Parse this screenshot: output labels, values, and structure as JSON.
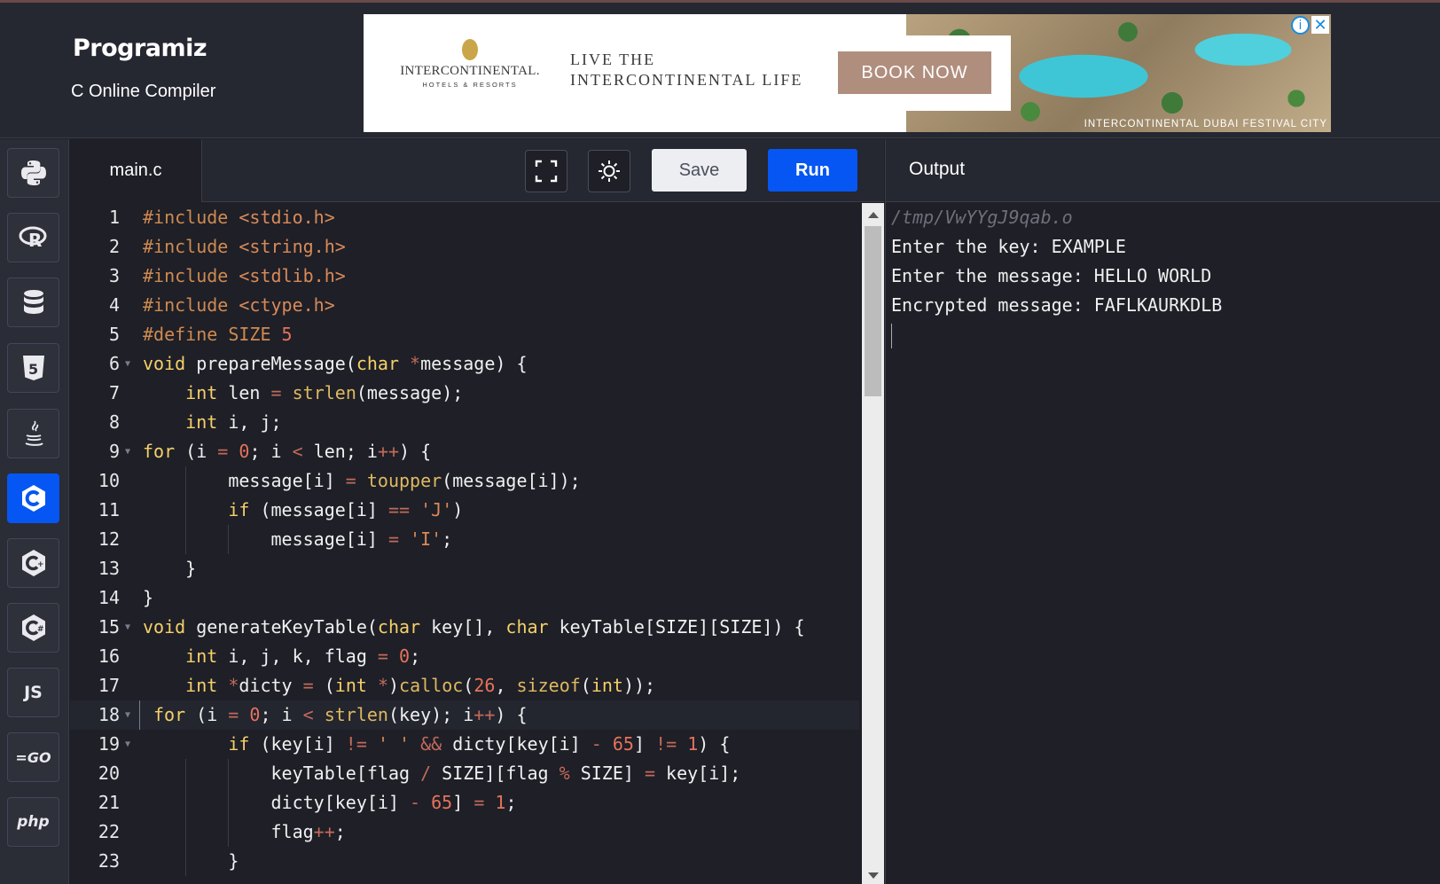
{
  "header": {
    "logo": "Programiz",
    "subtitle": "C Online Compiler"
  },
  "ad": {
    "brand": "INTERCONTINENTAL.",
    "brand_sub": "HOTELS & RESORTS",
    "tagline_1": "LIVE THE",
    "tagline_2": "INTERCONTINENTAL LIFE",
    "button": "BOOK NOW",
    "caption": "INTERCONTINENTAL DUBAI FESTIVAL CITY",
    "info": "i",
    "close": "✕"
  },
  "sidebar": {
    "items": [
      {
        "name": "python",
        "label": ""
      },
      {
        "name": "r",
        "label": "R"
      },
      {
        "name": "sql",
        "label": ""
      },
      {
        "name": "html",
        "label": "5"
      },
      {
        "name": "java",
        "label": ""
      },
      {
        "name": "c",
        "label": "C",
        "active": true
      },
      {
        "name": "cpp",
        "label": "C"
      },
      {
        "name": "csharp",
        "label": "C"
      },
      {
        "name": "javascript",
        "label": "JS"
      },
      {
        "name": "go",
        "label": "=GO"
      },
      {
        "name": "php",
        "label": "php"
      }
    ]
  },
  "editor": {
    "tab_label": "main.c",
    "save_label": "Save",
    "run_label": "Run",
    "lines": [
      {
        "n": "1",
        "fold": false
      },
      {
        "n": "2",
        "fold": false
      },
      {
        "n": "3",
        "fold": false
      },
      {
        "n": "4",
        "fold": false
      },
      {
        "n": "5",
        "fold": false
      },
      {
        "n": "6",
        "fold": true
      },
      {
        "n": "7",
        "fold": false
      },
      {
        "n": "8",
        "fold": false
      },
      {
        "n": "9",
        "fold": true
      },
      {
        "n": "10",
        "fold": false
      },
      {
        "n": "11",
        "fold": false
      },
      {
        "n": "12",
        "fold": false
      },
      {
        "n": "13",
        "fold": false
      },
      {
        "n": "14",
        "fold": false
      },
      {
        "n": "15",
        "fold": true
      },
      {
        "n": "16",
        "fold": false
      },
      {
        "n": "17",
        "fold": false
      },
      {
        "n": "18",
        "fold": true,
        "active": true
      },
      {
        "n": "19",
        "fold": true
      },
      {
        "n": "20",
        "fold": false
      },
      {
        "n": "21",
        "fold": false
      },
      {
        "n": "22",
        "fold": false
      },
      {
        "n": "23",
        "fold": false
      }
    ]
  },
  "output": {
    "title": "Output",
    "path": "/tmp/VwYYgJ9qab.o",
    "lines": [
      "Enter the key: EXAMPLE",
      "Enter the message: HELLO WORLD",
      "Encrypted message: FAFLKAURKDLB"
    ]
  },
  "colors": {
    "accent": "#0556f3",
    "background": "#1e1f27",
    "keyword": "#f6d06a",
    "string": "#d98a58",
    "number": "#e5735a"
  }
}
